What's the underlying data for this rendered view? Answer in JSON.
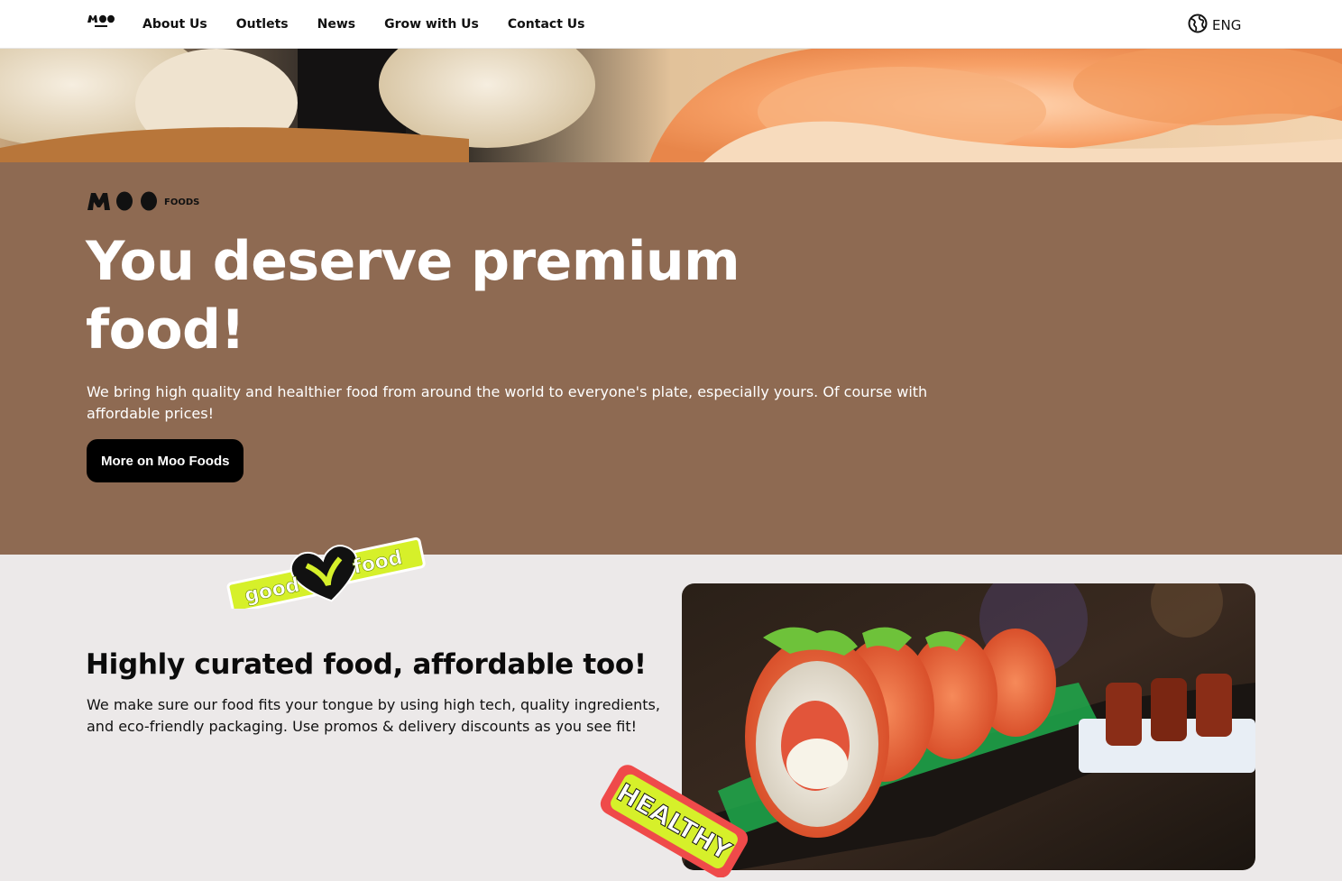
{
  "nav": {
    "logo_alt": "Moo Foods",
    "links": [
      "About Us",
      "Outlets",
      "News",
      "Grow with Us",
      "Contact Us"
    ],
    "language": "ENG"
  },
  "hero": {
    "brand": "MOO FOODS",
    "title": "You deserve premium food!",
    "description": "We bring high quality and healthier food from around the world to everyone's plate, especially yours. Of course with affordable prices!",
    "cta_label": "More on Moo Foods"
  },
  "section": {
    "title": "Highly curated food, affordable too!",
    "description": "We make sure our food fits your tongue by using high tech, quality ingredients, and eco-friendly packaging. Use promos & delivery discounts as you see fit!"
  },
  "stickers": {
    "good_left": "good",
    "good_right": "food",
    "healthy": "HEALTHY"
  },
  "colors": {
    "hero_bg": "#8e6a52",
    "page_bg": "#ece9e9",
    "sticker_green": "#d6f02a",
    "sticker_red": "#ef4a4a"
  }
}
